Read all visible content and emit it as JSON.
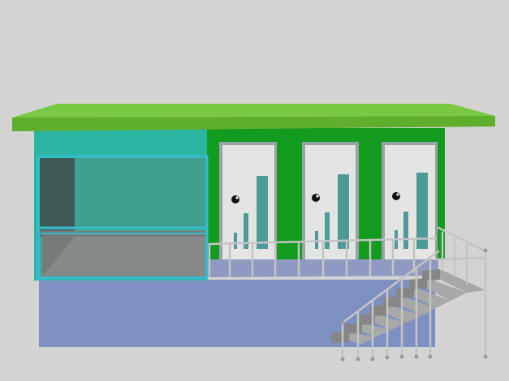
{
  "colors": {
    "background": "#d3d3d3",
    "roof_top": "#7ac943",
    "roof_front": "#5fae2c",
    "green_wall": "#139b20",
    "teal_wall": "#2bb5a0",
    "window_frame": "#36bcd0",
    "door": "#e4e4e4",
    "door_frame": "#9aa3a3",
    "door_bars": "#4f9a98",
    "platform": "#7e90c1",
    "platform_top": "#8a9ac6",
    "deck": "#8f99c2",
    "rail": "#c4c4c4",
    "step_top": "#a8a8a8",
    "step_front": "#868686"
  },
  "icons": [
    "door-knob-icon"
  ]
}
